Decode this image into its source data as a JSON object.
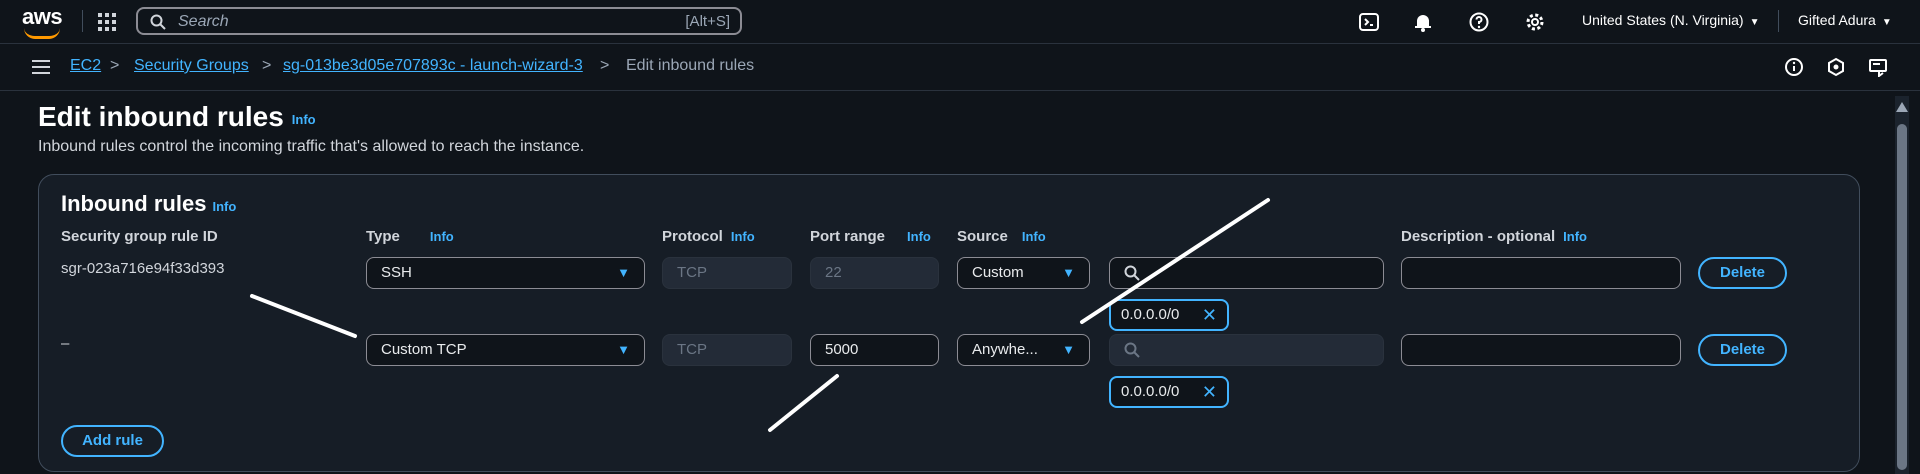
{
  "topbar": {
    "logo": "aws",
    "search_placeholder": "Search",
    "search_shortcut": "[Alt+S]",
    "region": "United States (N. Virginia)",
    "user": "Gifted Adura",
    "icons": [
      "cloudshell-icon",
      "bell-icon",
      "help-icon",
      "settings-icon"
    ]
  },
  "breadcrumb": {
    "items": [
      "EC2",
      "Security Groups",
      "sg-013be3d05e707893c - launch-wizard-3",
      "Edit inbound rules"
    ]
  },
  "page": {
    "title": "Edit inbound rules",
    "info": "Info",
    "description": "Inbound rules control the incoming traffic that's allowed to reach the instance."
  },
  "panel": {
    "title": "Inbound rules",
    "headers": {
      "rule_id": "Security group rule ID",
      "type": "Type",
      "protocol": "Protocol",
      "port_range": "Port range",
      "source": "Source",
      "description": "Description - optional"
    },
    "rows": [
      {
        "rule_id": "sgr-023a716e94f33d393",
        "type": "SSH",
        "protocol": "TCP",
        "port": "22",
        "source": "Custom",
        "cidr": "0.0.0.0/0",
        "description": "",
        "delete": "Delete"
      },
      {
        "rule_id": "–",
        "type": "Custom TCP",
        "protocol": "TCP",
        "port": "5000",
        "source": "Anywhe...",
        "cidr": "0.0.0.0/0",
        "description": "",
        "delete": "Delete"
      }
    ],
    "add_rule": "Add rule"
  },
  "colors": {
    "accent": "#42b4ff",
    "background": "#0f141a",
    "panel": "#161d26",
    "brand": "#ff9900"
  }
}
